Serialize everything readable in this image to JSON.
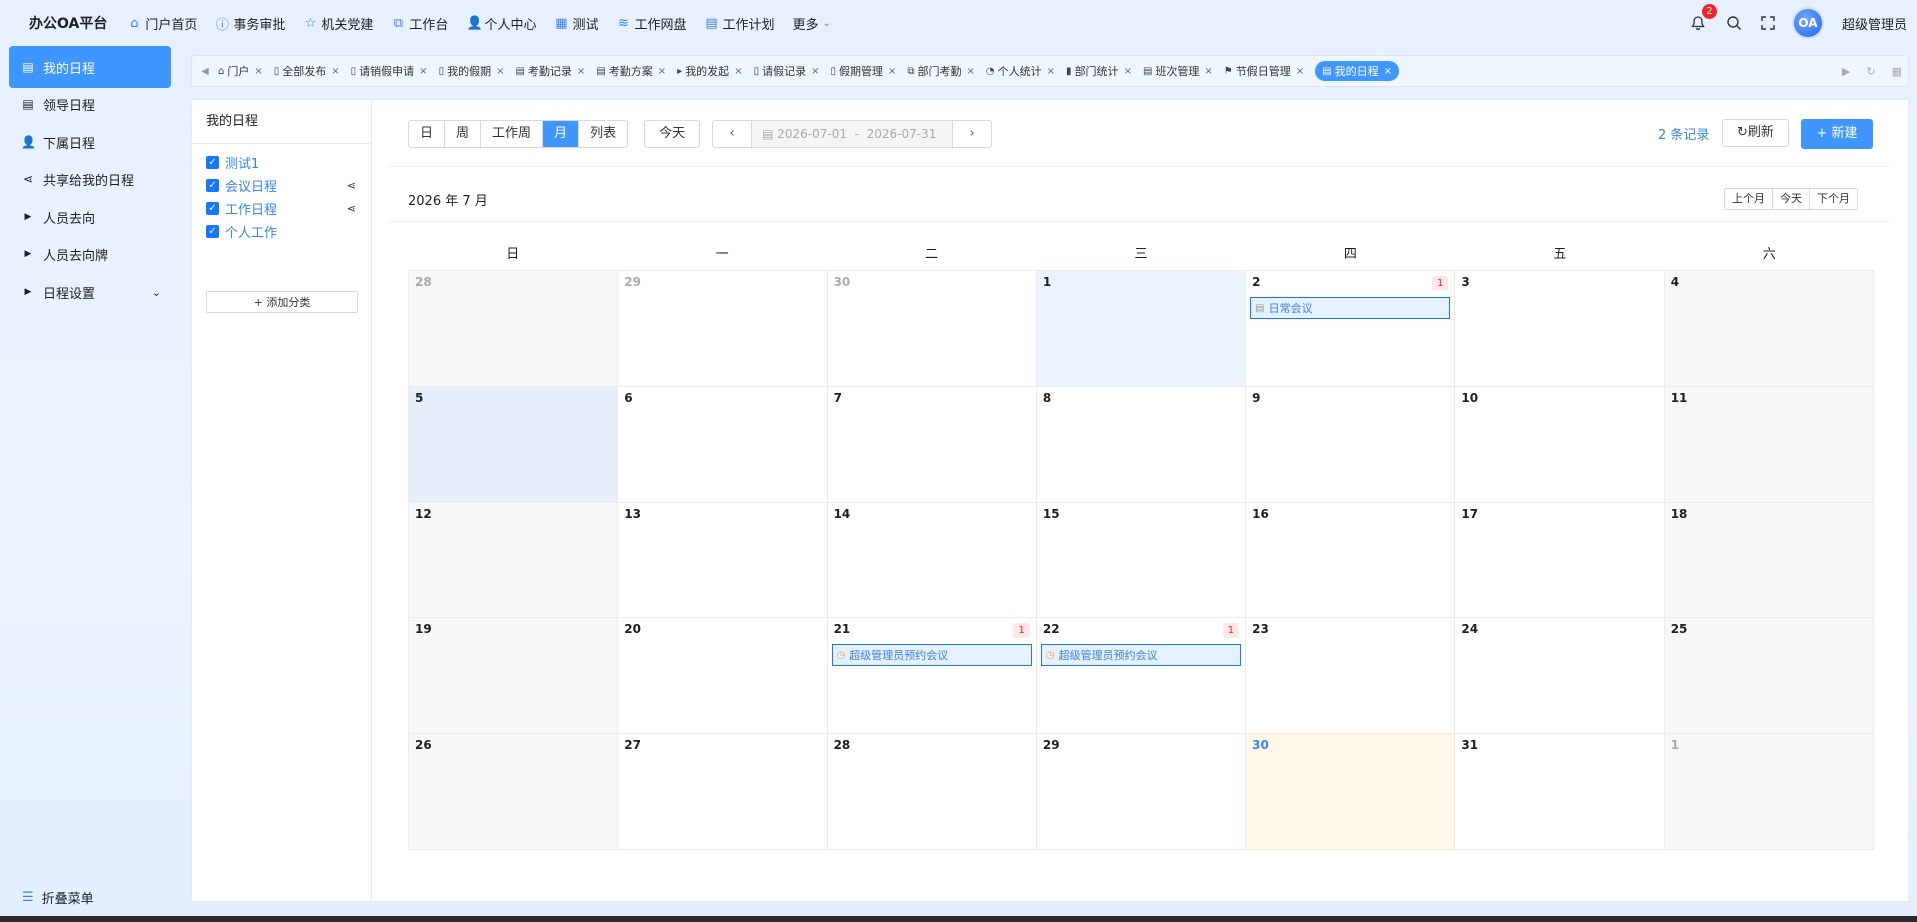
{
  "app": {
    "title": "办公OA平台"
  },
  "nav": {
    "items": [
      {
        "label": "门户首页",
        "icon": "home-icon",
        "glyph": "⌂"
      },
      {
        "label": "事务审批",
        "icon": "info-icon",
        "glyph": "ⓘ"
      },
      {
        "label": "机关党建",
        "icon": "star-icon",
        "glyph": "☆"
      },
      {
        "label": "工作台",
        "icon": "org-icon",
        "glyph": "⧉"
      },
      {
        "label": "个人中心",
        "icon": "user-icon",
        "glyph": "👤"
      },
      {
        "label": "测试",
        "icon": "grid-icon",
        "glyph": "▦"
      },
      {
        "label": "工作网盘",
        "icon": "database-icon",
        "glyph": "≋"
      },
      {
        "label": "工作计划",
        "icon": "calendar-icon",
        "glyph": "▤"
      }
    ],
    "more_label": "更多"
  },
  "header": {
    "notification_count": "2",
    "avatar_text": "OA",
    "username": "超级管理员"
  },
  "sidebar": {
    "items": [
      {
        "label": "我的日程",
        "icon": "calendar-icon",
        "glyph": "▤",
        "active": true
      },
      {
        "label": "领导日程",
        "icon": "calendar-icon",
        "glyph": "▤"
      },
      {
        "label": "下属日程",
        "icon": "user-icon",
        "glyph": "👤"
      },
      {
        "label": "共享给我的日程",
        "icon": "share-icon",
        "glyph": "⋖"
      },
      {
        "label": "人员去向",
        "icon": "caret-right-icon",
        "glyph": "▶"
      },
      {
        "label": "人员去向牌",
        "icon": "caret-right-icon",
        "glyph": "▶"
      },
      {
        "label": "日程设置",
        "icon": "caret-right-icon",
        "glyph": "▶"
      }
    ],
    "collapse_label": "折叠菜单"
  },
  "tabs": [
    {
      "label": "门户",
      "icon": "home-icon",
      "glyph": "⌂"
    },
    {
      "label": "全部发布",
      "icon": "doc-icon",
      "glyph": "▯"
    },
    {
      "label": "请销假申请",
      "icon": "doc-icon",
      "glyph": "▯"
    },
    {
      "label": "我的假期",
      "icon": "doc-icon",
      "glyph": "▯"
    },
    {
      "label": "考勤记录",
      "icon": "calendar-icon",
      "glyph": "▤"
    },
    {
      "label": "考勤方案",
      "icon": "calendar-check-icon",
      "glyph": "▤"
    },
    {
      "label": "我的发起",
      "icon": "caret-right-icon",
      "glyph": "▸"
    },
    {
      "label": "请假记录",
      "icon": "doc-icon",
      "glyph": "▯"
    },
    {
      "label": "假期管理",
      "icon": "doc-icon",
      "glyph": "▯"
    },
    {
      "label": "部门考勤",
      "icon": "org-icon",
      "glyph": "⧉"
    },
    {
      "label": "个人统计",
      "icon": "pie-chart-icon",
      "glyph": "◔"
    },
    {
      "label": "部门统计",
      "icon": "bar-chart-icon",
      "glyph": "▮"
    },
    {
      "label": "班次管理",
      "icon": "calendar-icon",
      "glyph": "▤"
    },
    {
      "label": "节假日管理",
      "icon": "flag-icon",
      "glyph": "⚑"
    },
    {
      "label": "我的日程",
      "icon": "calendar-icon",
      "glyph": "▤",
      "active": true
    }
  ],
  "categories": {
    "title": "我的日程",
    "items": [
      {
        "label": "测试1",
        "shared": false
      },
      {
        "label": "会议日程",
        "shared": true
      },
      {
        "label": "工作日程",
        "shared": true
      },
      {
        "label": "个人工作",
        "shared": false
      }
    ],
    "add_label": "+ 添加分类"
  },
  "toolbar": {
    "views": [
      "日",
      "周",
      "工作周",
      "月",
      "列表"
    ],
    "active_view": "月",
    "today_label": "今天",
    "date_start": "2026-07-01",
    "date_sep": "-",
    "date_end": "2026-07-31",
    "records_label": "2 条记录",
    "refresh_label": "刷新",
    "new_label": "+ 新建"
  },
  "calendar": {
    "month_title": "2026 年 7 月",
    "prev_month_label": "上个月",
    "today_label": "今天",
    "next_month_label": "下个月",
    "weekdays": [
      "日",
      "一",
      "二",
      "三",
      "四",
      "五",
      "六"
    ],
    "weeks": [
      [
        {
          "day": "28",
          "other": true,
          "weekend": true
        },
        {
          "day": "29",
          "other": true
        },
        {
          "day": "30",
          "other": true
        },
        {
          "day": "1",
          "state": "today-col"
        },
        {
          "day": "2",
          "count": "1",
          "events": [
            {
              "title": "日常会议",
              "icon": "doc-icon",
              "glyph": "▤"
            }
          ]
        },
        {
          "day": "3"
        },
        {
          "day": "4",
          "weekend": true
        }
      ],
      [
        {
          "day": "5",
          "state": "selected"
        },
        {
          "day": "6"
        },
        {
          "day": "7"
        },
        {
          "day": "8"
        },
        {
          "day": "9"
        },
        {
          "day": "10"
        },
        {
          "day": "11",
          "weekend": true
        }
      ],
      [
        {
          "day": "12",
          "weekend": true
        },
        {
          "day": "13"
        },
        {
          "day": "14"
        },
        {
          "day": "15"
        },
        {
          "day": "16"
        },
        {
          "day": "17"
        },
        {
          "day": "18",
          "weekend": true
        }
      ],
      [
        {
          "day": "19",
          "weekend": true
        },
        {
          "day": "20"
        },
        {
          "day": "21",
          "count": "1",
          "events": [
            {
              "title": "超级管理员预约会议",
              "icon": "clock-icon",
              "glyph": "◷"
            }
          ]
        },
        {
          "day": "22",
          "count": "1",
          "events": [
            {
              "title": "超级管理员预约会议",
              "icon": "clock-icon",
              "glyph": "◷"
            }
          ]
        },
        {
          "day": "23"
        },
        {
          "day": "24"
        },
        {
          "day": "25",
          "weekend": true
        }
      ],
      [
        {
          "day": "26",
          "weekend": true
        },
        {
          "day": "27"
        },
        {
          "day": "28"
        },
        {
          "day": "29"
        },
        {
          "day": "30",
          "state": "hl"
        },
        {
          "day": "31"
        },
        {
          "day": "1",
          "other": true,
          "weekend": true
        }
      ]
    ]
  }
}
